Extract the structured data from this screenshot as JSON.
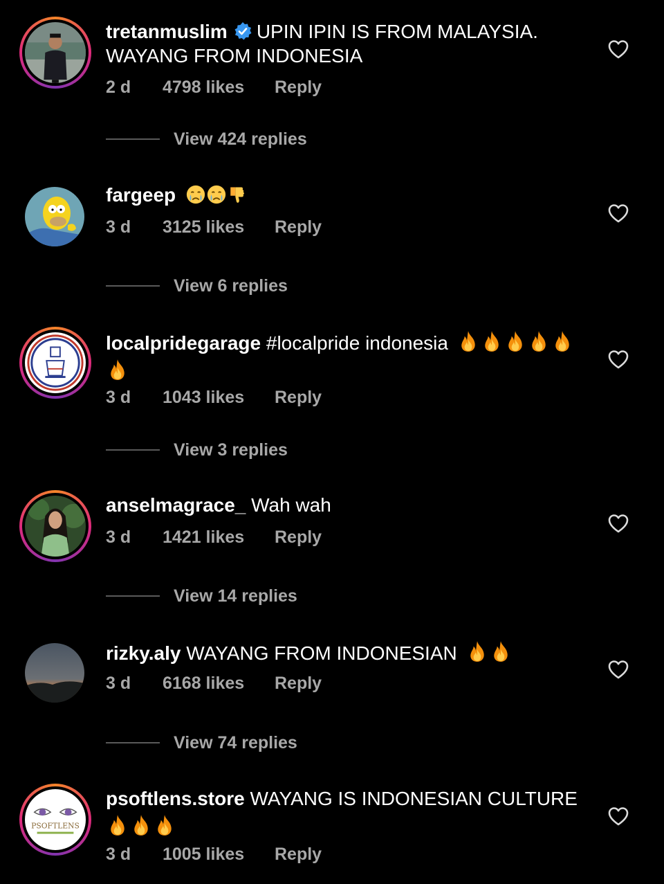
{
  "colors": {
    "background": "#000000",
    "text_primary": "#ffffff",
    "text_secondary": "#a8a8a8",
    "verified_blue": "#3897f0",
    "story_ring": [
      "#f58529",
      "#dd2a7b",
      "#8134af"
    ]
  },
  "comments": [
    {
      "username": "tretanmuslim",
      "verified": true,
      "text": "UPIN IPIN IS FROM MALAYSIA.",
      "text_line2": "WAYANG FROM INDONESIA",
      "time": "2 d",
      "likes": "4798 likes",
      "reply": "Reply",
      "view_replies": "View 424 replies",
      "avatar_icon": "man-portrait-avatar"
    },
    {
      "username": "fargeep",
      "text": "",
      "emojis": [
        "crying-face-emoji",
        "crying-face-emoji",
        "thumbs-down-emoji"
      ],
      "time": "3 d",
      "likes": "3125 likes",
      "reply": "Reply",
      "view_replies": "View 6 replies",
      "avatar_icon": "cartoon-character-avatar"
    },
    {
      "username": "localpridegarage",
      "text": "#localpride indonesia",
      "emojis": [
        "fire-emoji",
        "fire-emoji",
        "fire-emoji",
        "fire-emoji",
        "fire-emoji",
        "fire-emoji"
      ],
      "time": "3 d",
      "likes": "1043 likes",
      "reply": "Reply",
      "view_replies": "View 3 replies",
      "avatar_icon": "logo-badge-avatar"
    },
    {
      "username": "anselmagrace_",
      "text": "Wah wah",
      "time": "3 d",
      "likes": "1421 likes",
      "reply": "Reply",
      "view_replies": "View 14 replies",
      "avatar_icon": "woman-portrait-avatar"
    },
    {
      "username": "rizky.aly",
      "text": "WAYANG FROM INDONESIAN",
      "emojis": [
        "fire-emoji",
        "fire-emoji"
      ],
      "time": "3 d",
      "likes": "6168 likes",
      "reply": "Reply",
      "view_replies": "View 74 replies",
      "avatar_icon": "sunset-landscape-avatar"
    },
    {
      "username": "psoftlens.store",
      "text": "WAYANG IS INDONESIAN CULTURE",
      "emojis": [
        "fire-emoji",
        "fire-emoji",
        "fire-emoji"
      ],
      "time": "3 d",
      "likes": "1005 likes",
      "reply": "Reply",
      "avatar_icon": "psoftlens-logo-avatar",
      "avatar_logo_text": "PSOFTLENS"
    }
  ]
}
